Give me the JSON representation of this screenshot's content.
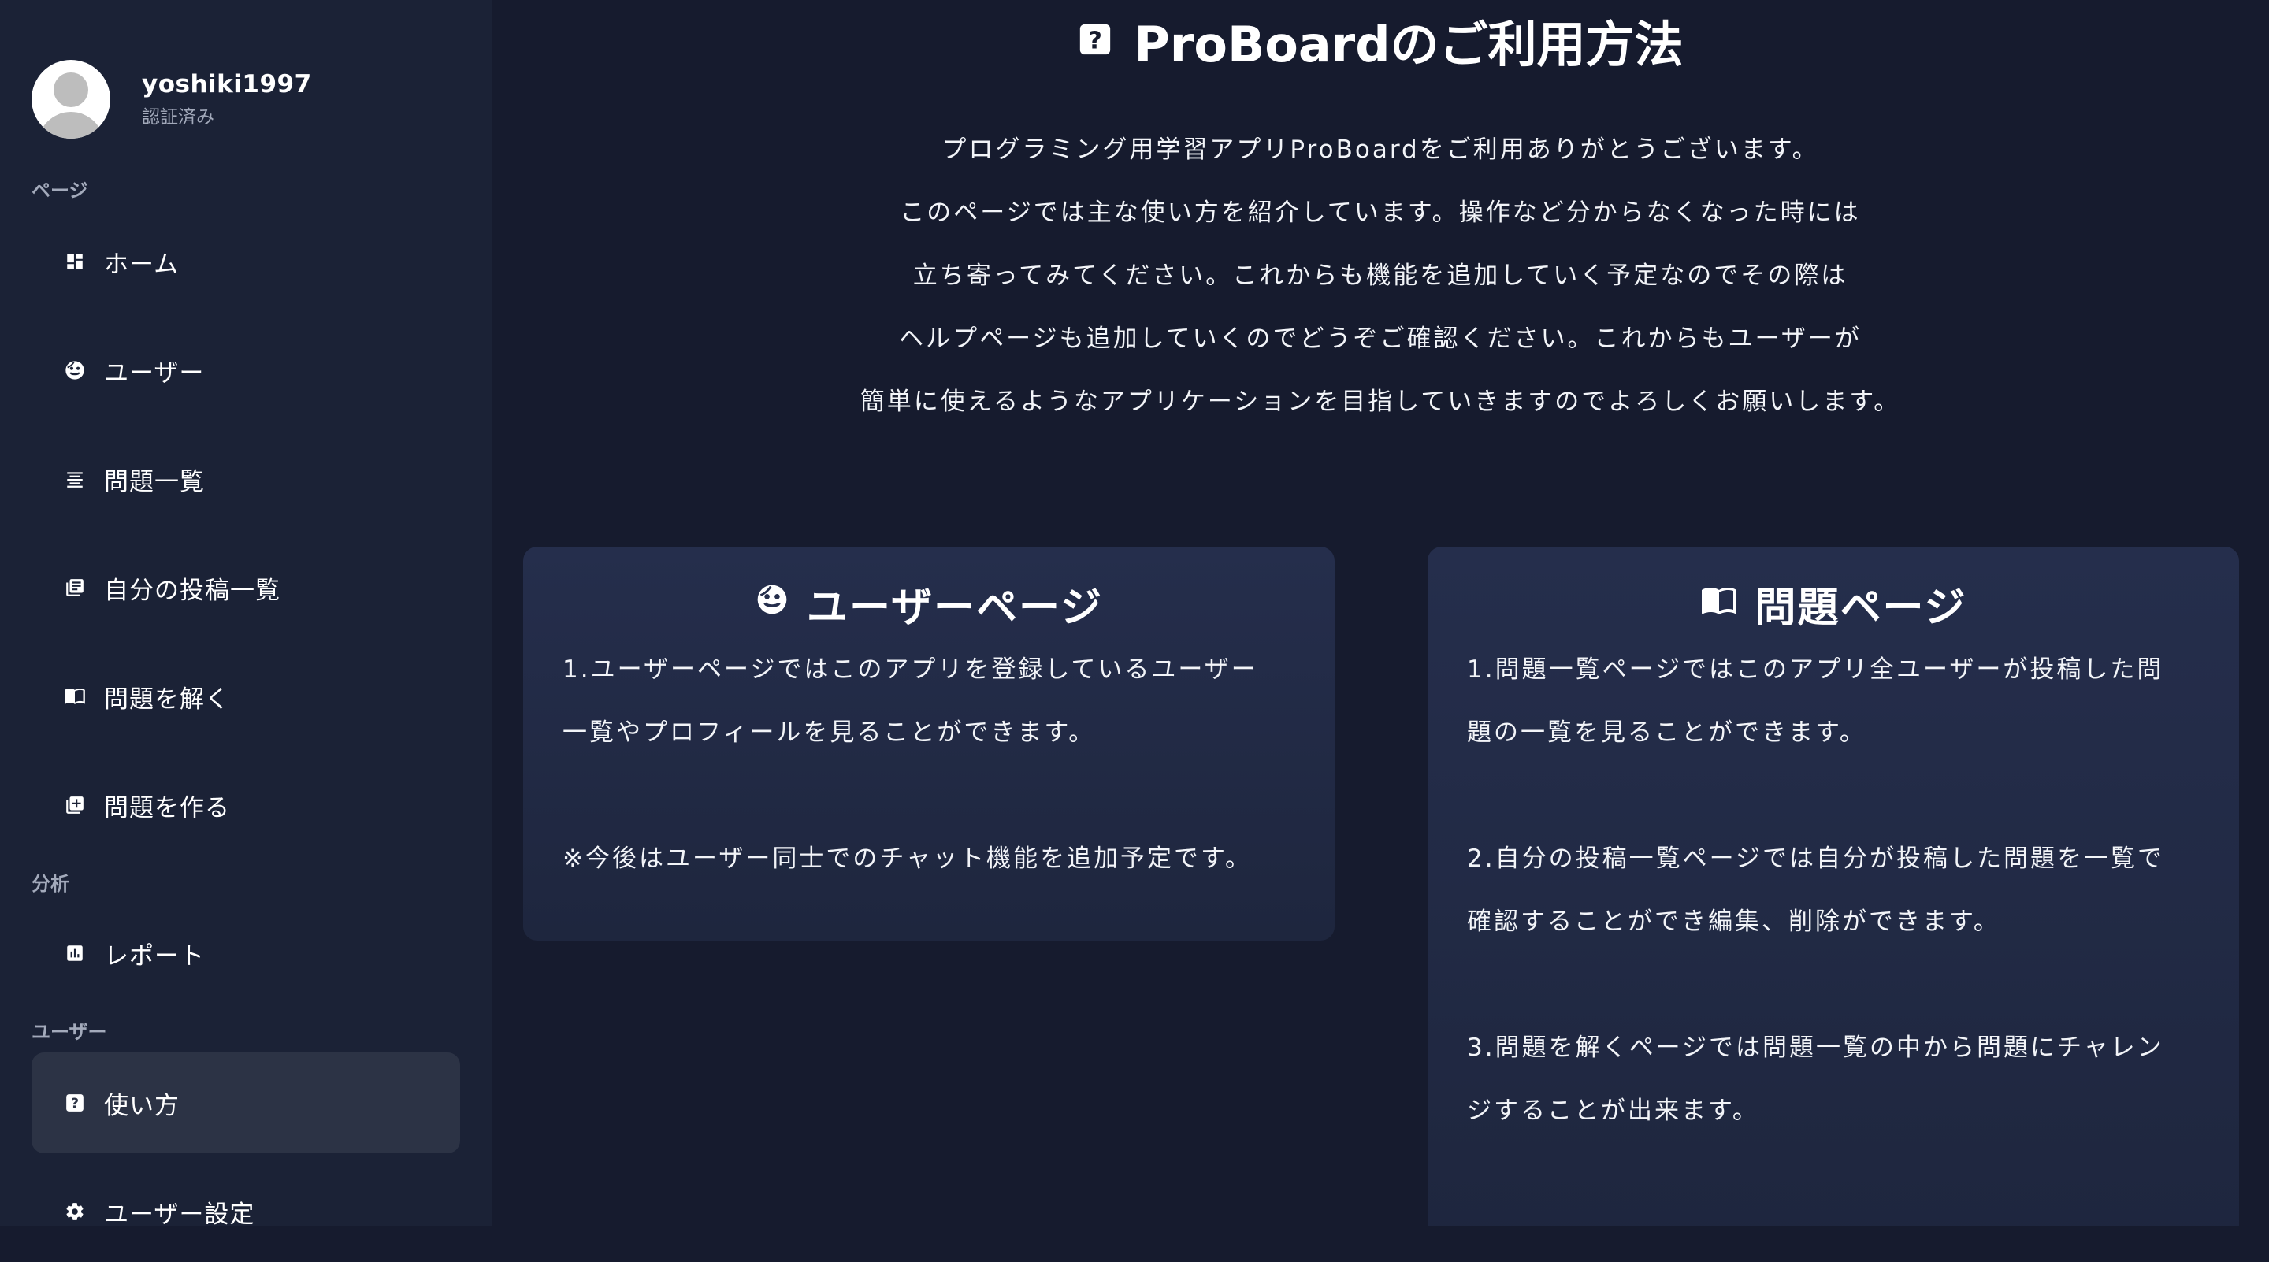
{
  "sidebar": {
    "profile": {
      "username": "yoshiki1997",
      "status": "認証済み"
    },
    "sections": {
      "pages": "ページ",
      "analysis": "分析",
      "user": "ユーザー"
    },
    "items": [
      {
        "label": "ホーム",
        "icon": "dashboard-icon"
      },
      {
        "label": "ユーザー",
        "icon": "face-icon"
      },
      {
        "label": "問題一覧",
        "icon": "list-icon"
      },
      {
        "label": "自分の投稿一覧",
        "icon": "library-books-icon"
      },
      {
        "label": "問題を解く",
        "icon": "book-icon"
      },
      {
        "label": "問題を作る",
        "icon": "add-box-icon"
      },
      {
        "label": "レポート",
        "icon": "chart-icon"
      },
      {
        "label": "使い方",
        "icon": "help-icon",
        "active": true
      },
      {
        "label": "ユーザー設定",
        "icon": "gear-icon"
      }
    ]
  },
  "main": {
    "title": "ProBoardのご利用方法",
    "intro": [
      "プログラミング用学習アプリProBoardをご利用ありがとうございます。",
      "このページでは主な使い方を紹介しています。操作など分からなくなった時には",
      "立ち寄ってみてください。これからも機能を追加していく予定なのでその際は",
      "ヘルプページも追加していくのでどうぞご確認ください。これからもユーザーが",
      "簡単に使えるようなアプリケーションを目指していきますのでよろしくお願いします。"
    ],
    "user_card": {
      "title": "ユーザーページ",
      "lines": [
        "1.ユーザーページではこのアプリを登録しているユーザー",
        "一覧やプロフィールを見ることができます。",
        "",
        "※今後はユーザー同士でのチャット機能を追加予定です。"
      ]
    },
    "problem_card": {
      "title": "問題ページ",
      "lines": [
        "1.問題一覧ページではこのアプリ全ユーザーが投稿した問",
        "題の一覧を見ることができます。",
        "",
        "2.自分の投稿一覧ページでは自分が投稿した問題を一覧で",
        "確認することができ編集、削除ができます。",
        "",
        "3.問題を解くページでは問題一覧の中から問題にチャレン",
        "ジすることが出来ます。"
      ]
    }
  }
}
